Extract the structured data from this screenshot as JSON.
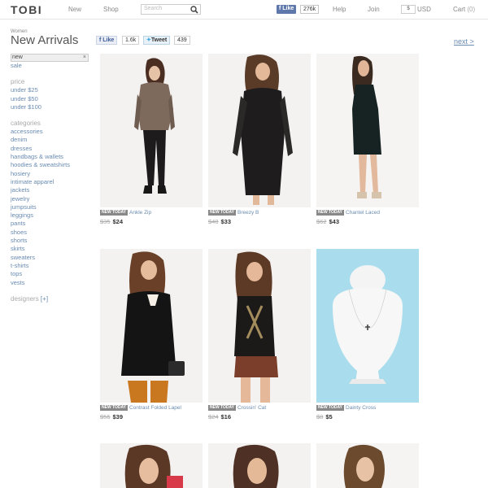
{
  "header": {
    "logo": "TOBI",
    "nav": [
      "New",
      "Shop"
    ],
    "search_placeholder": "Search",
    "fb_like": "Like",
    "fb_count": "276k",
    "help": "Help",
    "join": "Join",
    "currency_symbol": "$",
    "currency": "USD",
    "cart": "Cart",
    "cart_count": "(0)"
  },
  "title": {
    "crumb": "Women",
    "heading": "New Arrivals",
    "like_label": "Like",
    "like_count": "1.6k",
    "tweet_label": "Tweet",
    "tweet_count": "439",
    "next": "next >"
  },
  "sidebar": {
    "selected": "new",
    "clear": "×",
    "top": [
      "sale"
    ],
    "price_heading": "price",
    "prices": [
      "under $25",
      "under $50",
      "under $100"
    ],
    "cat_heading": "categories",
    "categories": [
      "accessories",
      "denim",
      "dresses",
      "handbags & wallets",
      "hoodies & sweatshirts",
      "hosiery",
      "intimate apparel",
      "jackets",
      "jewelry",
      "jumpsuits",
      "leggings",
      "pants",
      "shoes",
      "shorts",
      "skirts",
      "sweaters",
      "t-shirts",
      "tops",
      "vests"
    ],
    "designers_heading": "designers",
    "designers_toggle": "[+]"
  },
  "products": [
    {
      "badge": "NEW TODAY",
      "name": "Ankle Zip",
      "old": "$35",
      "new": "$24"
    },
    {
      "badge": "NEW TODAY",
      "name": "Breezy B",
      "old": "$48",
      "new": "$33"
    },
    {
      "badge": "NEW TODAY",
      "name": "Chantel Laced",
      "old": "$62",
      "new": "$43"
    },
    {
      "badge": "NEW TODAY",
      "name": "Contrast Folded Lapel",
      "old": "$56",
      "new": "$39"
    },
    {
      "badge": "NEW TODAY",
      "name": "Crossin' Cat",
      "old": "$24",
      "new": "$16"
    },
    {
      "badge": "NEW TODAY",
      "name": "Dainty Cross",
      "old": "$8",
      "new": "$5"
    }
  ],
  "colors": {
    "link": "#6a8bb1",
    "necklace_bg": "#a9dcec",
    "fb": "#5f78ab"
  }
}
